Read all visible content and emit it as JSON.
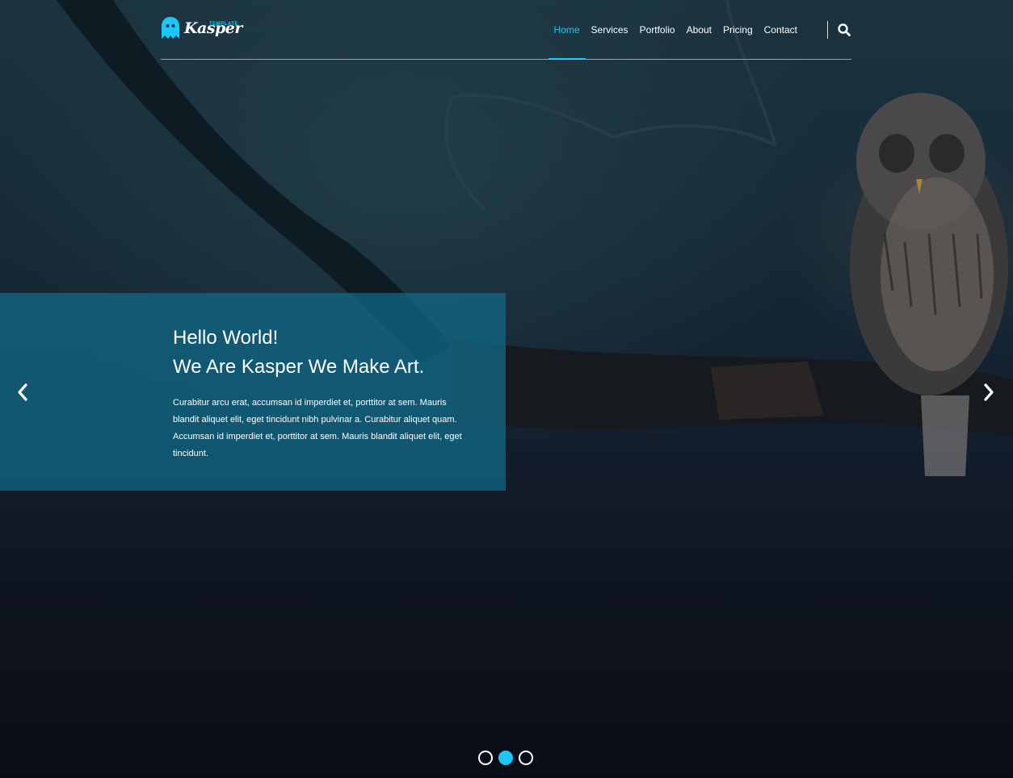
{
  "brand": {
    "name": "Kasper",
    "tagline": "TEMPLATE",
    "accent_color": "#19c8fa",
    "icon": "ghost-icon"
  },
  "nav": {
    "items": [
      {
        "label": "Home",
        "active": true
      },
      {
        "label": "Services",
        "active": false
      },
      {
        "label": "Portfolio",
        "active": false
      },
      {
        "label": "About",
        "active": false
      },
      {
        "label": "Pricing",
        "active": false
      },
      {
        "label": "Contact",
        "active": false
      }
    ],
    "search_icon": "search-icon"
  },
  "hero": {
    "heading_line1": "Hello World!",
    "heading_line2": "We Are Kasper We Make Art.",
    "paragraph": "Curabitur arcu erat, accumsan id imperdiet et, porttitor at sem. Mauris blandit aliquet elit, eget tincidunt nibh pulvinar a. Curabitur aliquet quam. Accumsan id imperdiet et, porttitor at sem. Mauris blandit aliquet elit, eget tincidunt.",
    "prev_icon": "chevron-left-icon",
    "next_icon": "chevron-right-icon"
  },
  "slider": {
    "slide_count": 3,
    "active_slide": 2
  }
}
